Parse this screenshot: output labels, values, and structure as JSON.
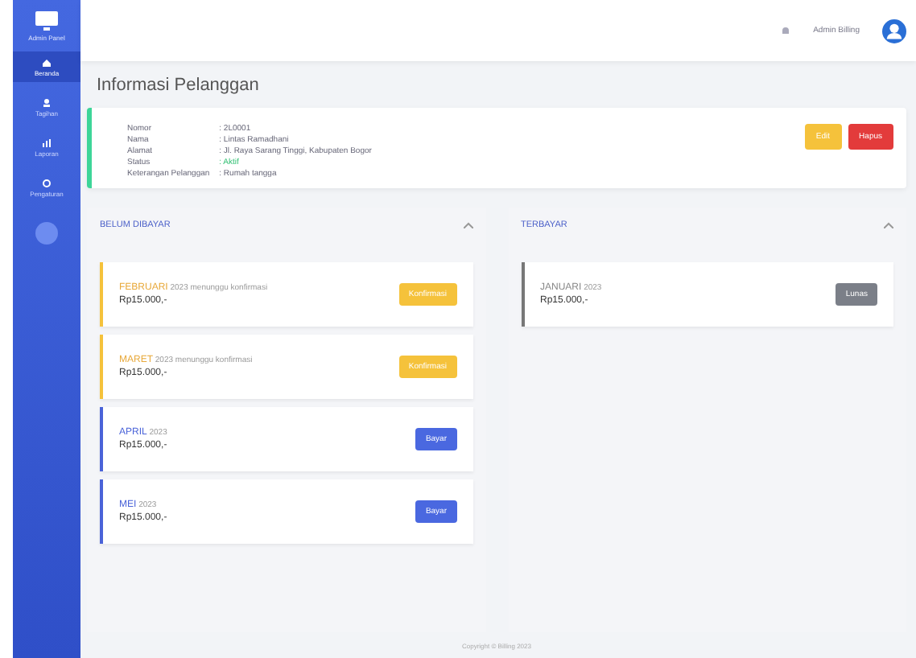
{
  "sidebar": {
    "brand": "Admin Panel",
    "items": [
      {
        "label": "Beranda",
        "selected": true
      },
      {
        "label": "Tagihan",
        "selected": false
      },
      {
        "label": "Laporan",
        "selected": false
      },
      {
        "label": "Pengaturan",
        "selected": false
      }
    ]
  },
  "topbar": {
    "user": "Admin Billing"
  },
  "page_title": "Informasi Pelanggan",
  "customer": {
    "fields": [
      {
        "label": "Nomor",
        "value": ": 2L0001",
        "kind": "text"
      },
      {
        "label": "Nama",
        "value": ": Lintas Ramadhani",
        "kind": "text"
      },
      {
        "label": "Alamat",
        "value": ": Jl. Raya Sarang Tinggi, Kabupaten Bogor",
        "kind": "text"
      },
      {
        "label": "Status",
        "value": ": Aktif",
        "kind": "status"
      },
      {
        "label": "Keterangan Pelanggan",
        "value": ": Rumah tangga",
        "kind": "text"
      }
    ],
    "buttons": [
      {
        "label": "Edit",
        "kind": "edit"
      },
      {
        "label": "Hapus",
        "kind": "delete"
      }
    ]
  },
  "columns": [
    {
      "title": "BELUM DIBAYAR",
      "bills": [
        {
          "month": "FEBRUARI",
          "note": "2023 menunggu konfirmasi",
          "amount": "Rp15.000,-",
          "kind": "pending",
          "action": "Konfirmasi"
        },
        {
          "month": "MARET",
          "note": "2023 menunggu konfirmasi",
          "amount": "Rp15.000,-",
          "kind": "pending",
          "action": "Konfirmasi"
        },
        {
          "month": "APRIL",
          "note": "2023",
          "amount": "Rp15.000,-",
          "kind": "unpaid",
          "action": "Bayar"
        },
        {
          "month": "MEI",
          "note": "2023",
          "amount": "Rp15.000,-",
          "kind": "unpaid",
          "action": "Bayar"
        }
      ]
    },
    {
      "title": "TERBAYAR",
      "bills": [
        {
          "month": "JANUARI",
          "note": "2023",
          "amount": "Rp15.000,-",
          "kind": "paid",
          "action": "Lunas"
        }
      ]
    }
  ],
  "footer": "Copyright © Billing 2023"
}
